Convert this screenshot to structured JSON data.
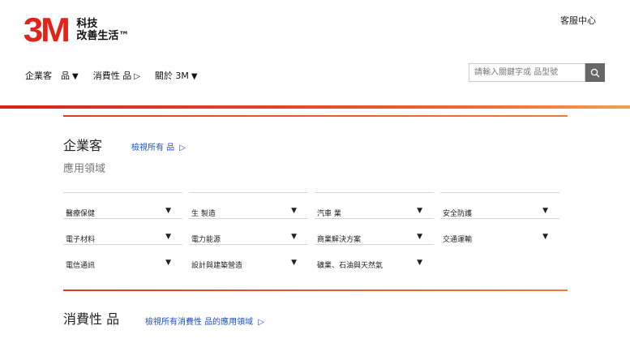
{
  "header": {
    "logo_mark": "3M",
    "logo_line1": "科技",
    "logo_line2": "改善生活™",
    "support_link": "客服中心"
  },
  "nav": {
    "items": [
      {
        "label": "企業客　品",
        "arrow": "▼"
      },
      {
        "label": "消費性 品",
        "arrow": "▷"
      },
      {
        "label": "關於 3M",
        "arrow": "▼"
      }
    ]
  },
  "search": {
    "placeholder": "請輸入關鍵字或 品型號"
  },
  "enterprise": {
    "title": "企業客",
    "view_all": "檢視所有 品",
    "view_all_arrow": "▷",
    "subtitle": "應用領域",
    "categories": [
      "醫療保健",
      "生 製造",
      "汽車 業",
      "安全防護",
      "電子材料",
      "電力能源",
      "商業解決方案",
      "交通運輸",
      "電信通訊",
      "設計與建築營造",
      "礦業、石油與天然氣"
    ]
  },
  "consumer": {
    "title": "消費性 品",
    "view_all": "檢視所有消費性 品的應用領域",
    "view_all_arrow": "▷"
  },
  "colors": {
    "brand_red": "#e2231a",
    "link_blue": "#1a4fc8",
    "search_button": "#666666"
  },
  "icons": {
    "search": "search-icon",
    "dropdown": "caret-down-icon"
  }
}
